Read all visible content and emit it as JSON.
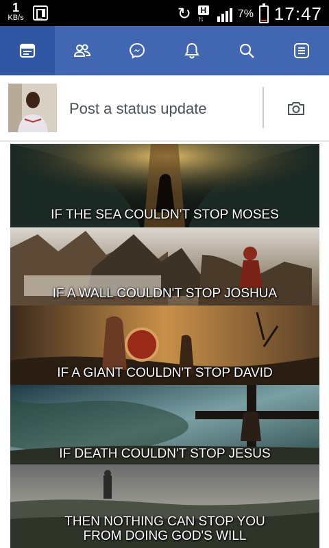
{
  "statusbar": {
    "data_rate_value": "1",
    "data_rate_unit": "KB/s",
    "network_type": "H",
    "battery_percent": "7%",
    "battery_level": 0.07,
    "time": "17:47"
  },
  "navbar": {
    "items": [
      {
        "icon": "news-feed-icon",
        "active": true
      },
      {
        "icon": "friends-icon",
        "active": false
      },
      {
        "icon": "messenger-icon",
        "active": false
      },
      {
        "icon": "notifications-bell-icon",
        "active": false
      },
      {
        "icon": "search-icon",
        "active": false
      },
      {
        "icon": "menu-icon",
        "active": false
      }
    ],
    "bg_color": "#4267b2",
    "active_color": "#2f56a2"
  },
  "composer": {
    "placeholder": "Post a status update",
    "camera_icon": "camera-icon"
  },
  "post": {
    "image_captions": [
      "IF THE SEA COULDN'T STOP MOSES",
      "IF A WALL COULDN'T STOP JOSHUA",
      "IF A GIANT COULDN'T STOP DAVID",
      "IF DEATH COULDN'T STOP JESUS",
      "THEN NOTHING CAN STOP YOU",
      "FROM DOING GOD'S WILL"
    ]
  }
}
